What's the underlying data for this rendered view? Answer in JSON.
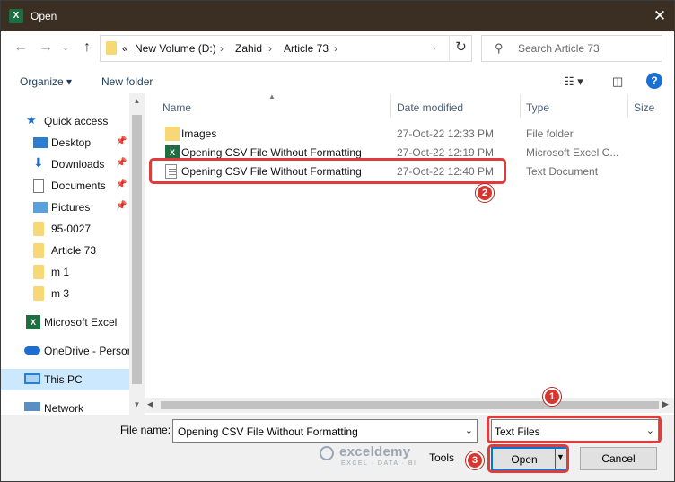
{
  "window": {
    "title": "Open",
    "app_icon_letter": "X",
    "close_glyph": "✕"
  },
  "address": {
    "overflow": "«",
    "crumbs": [
      "New Volume (D:)",
      "Zahid",
      "Article 73"
    ],
    "sep": "›"
  },
  "search": {
    "placeholder": "Search Article 73"
  },
  "toolbar": {
    "organize": "Organize ▾",
    "new_folder": "New folder",
    "help": "?"
  },
  "nav": {
    "items": [
      {
        "label": "Quick access",
        "icon": "star-icon"
      },
      {
        "label": "Desktop",
        "icon": "desktop-icon",
        "pinned": true
      },
      {
        "label": "Downloads",
        "icon": "download-icon",
        "pinned": true
      },
      {
        "label": "Documents",
        "icon": "documents-icon",
        "pinned": true
      },
      {
        "label": "Pictures",
        "icon": "pictures-icon",
        "pinned": true
      },
      {
        "label": "95-0027",
        "icon": "folder-icon"
      },
      {
        "label": "Article 73",
        "icon": "folder-icon"
      },
      {
        "label": "m 1",
        "icon": "folder-icon"
      },
      {
        "label": "m 3",
        "icon": "folder-icon"
      },
      {
        "label": "Microsoft Excel",
        "icon": "excel-icon"
      },
      {
        "label": "OneDrive - Persor",
        "icon": "onedrive-icon"
      },
      {
        "label": "This PC",
        "icon": "pc-icon",
        "selected": true
      },
      {
        "label": "Network",
        "icon": "network-icon"
      }
    ]
  },
  "columns": {
    "name": "Name",
    "date": "Date modified",
    "type": "Type",
    "size": "Size"
  },
  "files": [
    {
      "name": "Images",
      "date": "27-Oct-22 12:33 PM",
      "type": "File folder",
      "icon": "folder-icon"
    },
    {
      "name": "Opening CSV File Without Formatting",
      "date": "27-Oct-22 12:19 PM",
      "type": "Microsoft Excel C...",
      "icon": "excel-csv-icon"
    },
    {
      "name": "Opening CSV File Without Formatting",
      "date": "27-Oct-22 12:40 PM",
      "type": "Text Document",
      "icon": "text-file-icon"
    }
  ],
  "bottom": {
    "file_name_label": "File name:",
    "file_name_value": "Opening CSV File Without Formatting",
    "filter_value": "Text Files",
    "tools": "Tools",
    "open": "Open",
    "cancel": "Cancel"
  },
  "annotations": {
    "badges": [
      "1",
      "2",
      "3"
    ],
    "highlight_color": "#e03c3c"
  },
  "watermark": {
    "name": "exceldemy",
    "tagline": "EXCEL · DATA · BI"
  },
  "colors": {
    "title_bar": "#3b2f23",
    "selection": "#cce8ff",
    "accent": "#0078d7"
  }
}
